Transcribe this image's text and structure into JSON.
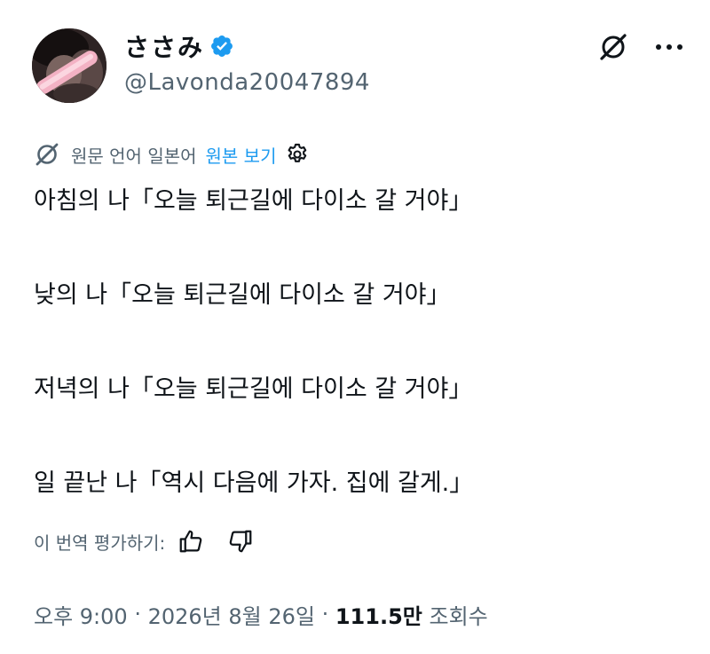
{
  "author": {
    "display_name": "ささみ",
    "handle": "@Lavonda20047894",
    "verified": true
  },
  "header": {
    "grok_icon": "grok-icon",
    "more_icon": "more-horizontal-icon"
  },
  "translation": {
    "label": "원문 언어 일본어",
    "show_original": "원본 보기",
    "icon": "grok-translate-icon",
    "settings_icon": "gear-icon"
  },
  "tweet": {
    "lines": [
      "아침의 나「오늘 퇴근길에 다이소 갈 거야」",
      "낮의 나「오늘 퇴근길에 다이소 갈 거야」",
      "저녁의 나「오늘 퇴근길에 다이소 갈 거야」",
      "일 끝난 나「역시 다음에 가자. 집에 갈게.」"
    ]
  },
  "rating": {
    "label": "이 번역 평가하기:",
    "thumbs_up_icon": "thumbs-up-icon",
    "thumbs_down_icon": "thumbs-down-icon"
  },
  "meta": {
    "time": "오후 9:00",
    "separator": " · ",
    "date": "2026년 8월 26일",
    "views_count": "111.5만",
    "views_label": "조회수"
  },
  "colors": {
    "text": "#0f1419",
    "secondary": "#536471",
    "link": "#1d9bf0",
    "verified": "#1d9bf0"
  }
}
